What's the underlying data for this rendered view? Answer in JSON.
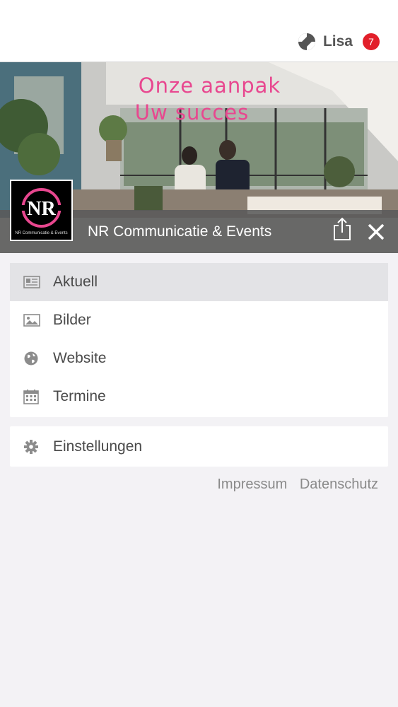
{
  "topbar": {
    "user_name": "Lisa",
    "notification_count": "7"
  },
  "hero": {
    "slogan_line1": "Onze aanpak",
    "slogan_line2": "Uw succes",
    "org_name": "NR Communicatie & Events",
    "logo_letters": "NR",
    "logo_subtitle": "NR Communicatie & Events"
  },
  "menu": {
    "items": [
      {
        "label": "Aktuell",
        "icon": "newspaper-icon"
      },
      {
        "label": "Bilder",
        "icon": "image-icon"
      },
      {
        "label": "Website",
        "icon": "globe-icon"
      },
      {
        "label": "Termine",
        "icon": "calendar-icon"
      }
    ],
    "settings_label": "Einstellungen"
  },
  "footer": {
    "impressum": "Impressum",
    "datenschutz": "Datenschutz"
  },
  "colors": {
    "accent_pink": "#e8478f",
    "badge_red": "#e21f2a"
  }
}
